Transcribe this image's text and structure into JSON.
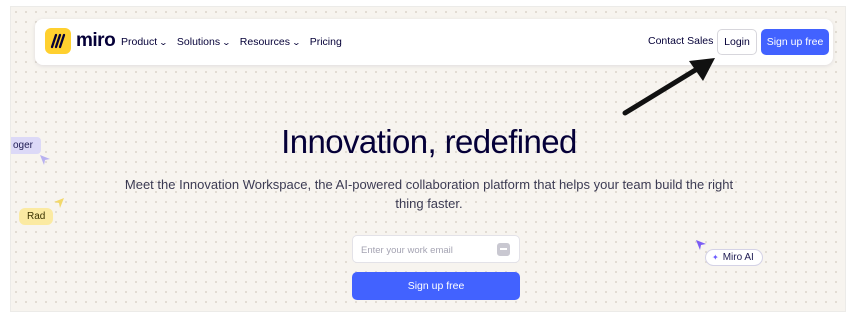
{
  "header": {
    "logo_text": "miro",
    "nav_items": [
      {
        "label": "Product",
        "has_dropdown": true
      },
      {
        "label": "Solutions",
        "has_dropdown": true
      },
      {
        "label": "Resources",
        "has_dropdown": true
      },
      {
        "label": "Pricing",
        "has_dropdown": false
      }
    ],
    "contact_label": "Contact Sales",
    "login_label": "Login",
    "signup_label": "Sign up free"
  },
  "hero": {
    "title": "Innovation, redefined",
    "subtitle": "Meet the Innovation Workspace, the AI-powered collaboration platform that helps your team build the right thing faster.",
    "email_value": "",
    "email_placeholder": "Enter your work email",
    "signup_label": "Sign up free"
  },
  "collaborators": {
    "roger_label": "oger",
    "rad_label": "Rad",
    "ai_label": "Miro AI"
  },
  "colors": {
    "brand_yellow": "#ffd02f",
    "primary_blue": "#4262ff",
    "text_dark": "#050038",
    "canvas_bg": "#f7f4ef"
  },
  "icons": {
    "logo": "miro-logo-icon",
    "chevron": "chevron-down-icon",
    "password_manager": "password-key-icon",
    "annotation": "arrow-annotation-icon"
  }
}
